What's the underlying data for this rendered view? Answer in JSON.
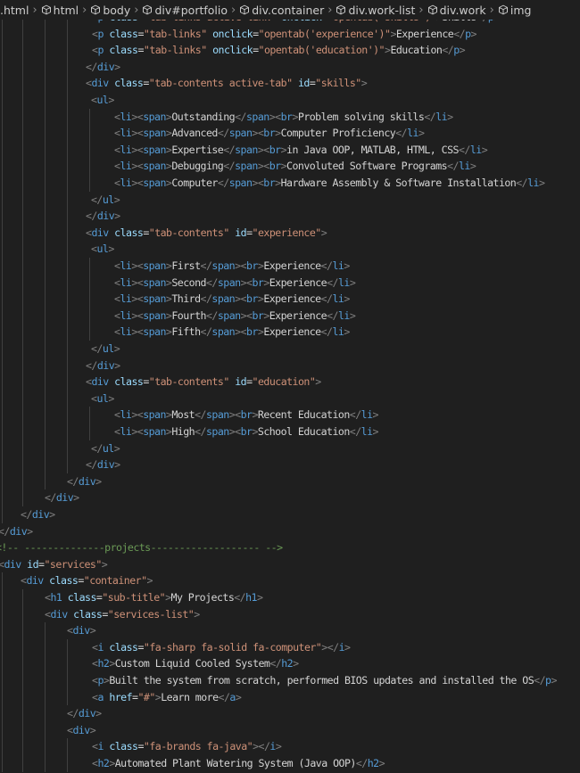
{
  "breadcrumb": [
    {
      "label": ".html",
      "icon": null
    },
    {
      "label": "html",
      "icon": "symbol-cube-icon"
    },
    {
      "label": "body",
      "icon": "symbol-cube-icon"
    },
    {
      "label": "div#portfolio",
      "icon": "symbol-cube-icon"
    },
    {
      "label": "div.container",
      "icon": "symbol-cube-icon"
    },
    {
      "label": "div.work-list",
      "icon": "symbol-cube-icon"
    },
    {
      "label": "div.work",
      "icon": "symbol-cube-icon"
    },
    {
      "label": "img",
      "icon": "symbol-cube-icon"
    }
  ],
  "colors": {
    "tag": "#569cd6",
    "bracket": "#808080",
    "attribute": "#9cdcfe",
    "string": "#ce9178",
    "text": "#d4d4d4",
    "comment": "#6a9955",
    "background": "#1f1f1f"
  },
  "code_lines": [
    "<p class=\"tab-links active-link\" onclick=\"opentab('skills')\">Skills</p>",
    "<p class=\"tab-links\" onclick=\"opentab('experience')\">Experience</p>",
    "<p class=\"tab-links\" onclick=\"opentab('education')\">Education</p>",
    "</div>",
    "<div class=\"tab-contents active-tab\" id=\"skills\">",
    "<ul>",
    "<li><span>Outstanding</span><br>Problem solving skills</li>",
    "<li><span>Advanced</span><br>Computer Proficiency</li>",
    "<li><span>Expertise</span><br>in Java OOP, MATLAB, HTML, CSS</li>",
    "<li><span>Debugging</span><br>Convoluted Software Programs</li>",
    "<li><span>Computer</span><br>Hardware Assembly & Software Installation</li>",
    "</ul>",
    "</div>",
    "<div class=\"tab-contents\" id=\"experience\">",
    "<ul>",
    "<li><span>First</span><br>Experience</li>",
    "<li><span>Second</span><br>Experience</li>",
    "<li><span>Third</span><br>Experience</li>",
    "<li><span>Fourth</span><br>Experience</li>",
    "<li><span>Fifth</span><br>Experience</li>",
    "</ul>",
    "</div>",
    "<div class=\"tab-contents\" id=\"education\">",
    "<ul>",
    "<li><span>Most</span><br>Recent Education</li>",
    "<li><span>High</span><br>School Education</li>",
    "</ul>",
    "</div>",
    "</div>",
    "</div>",
    "</div>",
    "</div>",
    "<!-- --------------projects------------------- -->",
    "<div id=\"services\">",
    "<div class=\"container\">",
    "<h1 class=\"sub-title\">My Projects</h1>",
    "<div class=\"services-list\">",
    "<div>",
    "<i class=\"fa-sharp fa-solid fa-computer\"></i>",
    "<h2>Custom Liquid Cooled System</h2>",
    "<p>Built the system from scratch, performed BIOS updates and installed the OS</p>",
    "<a href=\"#\">Learn more</a>",
    "</div>",
    "<div>",
    "<i class=\"fa-brands fa-java\"></i>",
    "<h2>Automated Plant Watering System (Java OOP)</h2>"
  ]
}
